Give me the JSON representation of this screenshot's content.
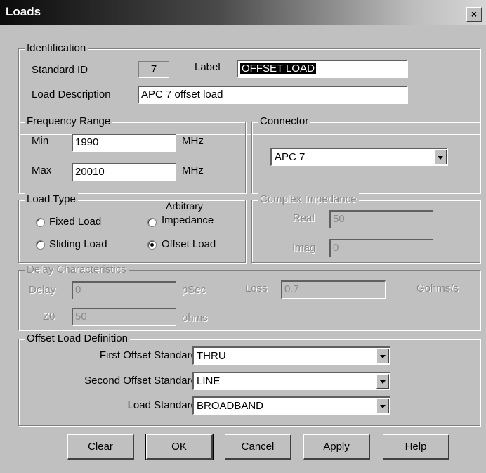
{
  "window": {
    "title": "Loads",
    "close": "×"
  },
  "identification": {
    "legend": "Identification",
    "standard_id_label": "Standard ID",
    "standard_id_value": "7",
    "label_label": "Label",
    "label_value": "OFFSET LOAD",
    "description_label": "Load Description",
    "description_value": "APC 7 offset load"
  },
  "frequency": {
    "legend": "Frequency Range",
    "min_label": "Min",
    "min_value": "1990",
    "min_unit": "MHz",
    "max_label": "Max",
    "max_value": "20010",
    "max_unit": "MHz"
  },
  "connector": {
    "legend": "Connector",
    "selected": "APC 7"
  },
  "load_type": {
    "legend": "Load Type",
    "options": [
      {
        "label": "Fixed Load",
        "checked": false
      },
      {
        "label": "Sliding Load",
        "checked": false
      },
      {
        "label_line1": "Arbitrary",
        "label_line2": "Impedance",
        "checked": false
      },
      {
        "label": "Offset Load",
        "checked": true
      }
    ]
  },
  "complex_impedance": {
    "legend": "Complex Impedance",
    "real_label": "Real",
    "real_value": "50",
    "imag_label": "Imag",
    "imag_value": "0"
  },
  "delay": {
    "legend": "Delay Characteristics",
    "delay_label": "Delay",
    "delay_value": "0",
    "delay_unit": "pSec",
    "loss_label": "Loss",
    "loss_value": "0.7",
    "loss_unit": "Gohms/s",
    "z0_label": "Z0",
    "z0_value": "50",
    "z0_unit": "ohms"
  },
  "offset_load": {
    "legend": "Offset Load Definition",
    "first_label": "First Offset Standard",
    "first_value": "THRU",
    "second_label": "Second Offset Standard",
    "second_value": "LINE",
    "load_label": "Load Standard",
    "load_value": "BROADBAND"
  },
  "buttons": {
    "clear": "Clear",
    "ok": "OK",
    "cancel": "Cancel",
    "apply": "Apply",
    "help": "Help"
  }
}
